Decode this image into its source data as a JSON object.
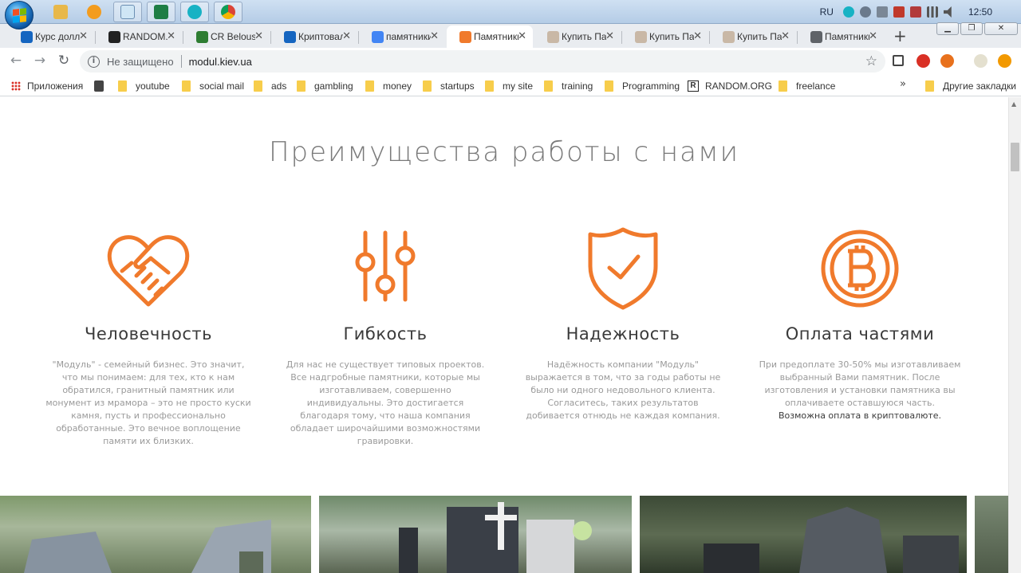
{
  "os": {
    "language": "RU",
    "clock": "12:50",
    "taskbar_apps": [
      "file-explorer",
      "media-player",
      "notepad",
      "excel",
      "kodi",
      "chrome"
    ]
  },
  "browser": {
    "tabs": [
      {
        "title": "Курс доллара",
        "icon": "info-icon",
        "color": "#1565c0"
      },
      {
        "title": "RANDOM.ORG",
        "icon": "random-org-icon",
        "color": "#222222"
      },
      {
        "title": "CR Belousov",
        "icon": "cr-icon",
        "color": "#2e7d32"
      },
      {
        "title": "Криптовалюты",
        "icon": "h-icon",
        "color": "#1565c0"
      },
      {
        "title": "памятники",
        "icon": "google-icon",
        "color": "#4285f4"
      },
      {
        "title": "Памятники",
        "icon": "modul-icon",
        "color": "#f07a2c",
        "active": true
      },
      {
        "title": "Купить Памятник",
        "icon": "tm-icon",
        "color": "#c9b8a6"
      },
      {
        "title": "Купить Памятник",
        "icon": "tm-icon",
        "color": "#c9b8a6"
      },
      {
        "title": "Купить Памятник",
        "icon": "tm-icon",
        "color": "#c9b8a6"
      },
      {
        "title": "Памятники",
        "icon": "globe-icon",
        "color": "#5f6368"
      }
    ],
    "security_label": "Не защищено",
    "url": "modul.kiev.ua",
    "bookmarks": [
      {
        "label": "Приложения",
        "icon": "apps-icon"
      },
      {
        "label": "",
        "icon": "calculator-icon"
      },
      {
        "label": "youtube",
        "icon": "folder-icon"
      },
      {
        "label": "social mail",
        "icon": "folder-icon"
      },
      {
        "label": "ads",
        "icon": "folder-icon"
      },
      {
        "label": "gambling",
        "icon": "folder-icon"
      },
      {
        "label": "money",
        "icon": "folder-icon"
      },
      {
        "label": "startups",
        "icon": "folder-icon"
      },
      {
        "label": "my site",
        "icon": "folder-icon"
      },
      {
        "label": "training",
        "icon": "folder-icon"
      },
      {
        "label": "Programming",
        "icon": "folder-icon"
      },
      {
        "label": "RANDOM.ORG",
        "icon": "random-org-icon"
      },
      {
        "label": "freelance",
        "icon": "folder-icon"
      }
    ],
    "bookmarks_more": "»",
    "other_bookmarks": "Другие закладки"
  },
  "page": {
    "accent_color": "#f07a2c",
    "section_title": "Преимущества работы с нами",
    "features": [
      {
        "icon": "handshake-heart-icon",
        "title": "Человечность",
        "text": "\"Модуль\" - семейный бизнес. Это значит, что мы понимаем: для тех, кто к нам обратился, гранитный памятник или монумент из мрамора – это не просто куски камня, пусть и профессионально обработанные. Это вечное воплощение памяти их близких.",
        "highlight": ""
      },
      {
        "icon": "sliders-icon",
        "title": "Гибкость",
        "text": "Для нас не существует типовых проектов. Все надгробные памятники, которые мы изготавливаем, совершенно индивидуальны. Это достигается благодаря тому, что наша компания обладает широчайшими возможностями гравировки.",
        "highlight": ""
      },
      {
        "icon": "shield-check-icon",
        "title": "Надежность",
        "text": "Надёжность компании \"Модуль\" выражается в том, что за годы работы не было ни одного недовольного клиента. Согласитесь, таких результатов добивается отнюдь не каждая компания.",
        "highlight": ""
      },
      {
        "icon": "bitcoin-icon",
        "title": "Оплата частями",
        "text": "При предоплате 30-50% мы изготавливаем выбранный Вами памятник. После изготовления и установки памятника вы оплачиваете оставшуюся часть.",
        "highlight": "Возможна оплата в криптовалюте."
      }
    ]
  }
}
